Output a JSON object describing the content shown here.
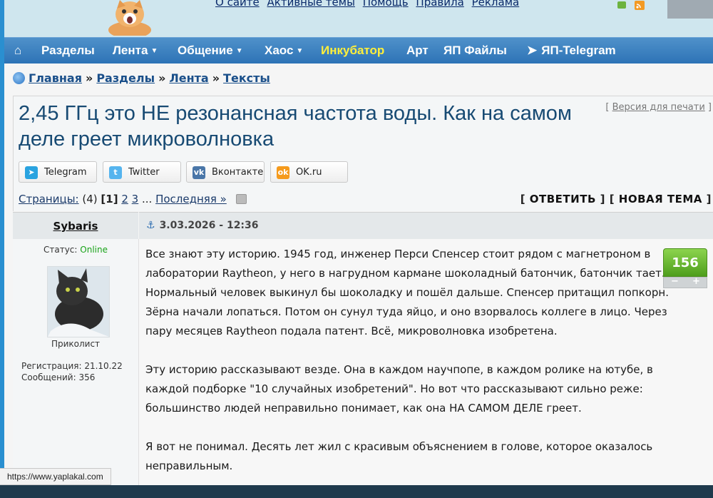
{
  "header": {
    "top_links": [
      "О сайте",
      "Активные темы",
      "Помощь",
      "Правила",
      "Реклама"
    ]
  },
  "navbar": {
    "items": [
      {
        "label": "Разделы",
        "dropdown": false
      },
      {
        "label": "Лента",
        "dropdown": true
      },
      {
        "label": "Общение",
        "dropdown": true
      },
      {
        "label": "Хаос",
        "dropdown": true
      },
      {
        "label": "Инкубатор",
        "dropdown": false,
        "highlight": true
      },
      {
        "label": "Арт",
        "dropdown": false
      },
      {
        "label": "ЯП Файлы",
        "dropdown": false
      },
      {
        "label": "ЯП-Telegram",
        "dropdown": false
      }
    ]
  },
  "breadcrumb": [
    "Главная",
    "Разделы",
    "Лента",
    "Тексты"
  ],
  "topic": {
    "title": "2,45 ГГц это НЕ резонансная частота воды. Как на самом деле греет микроволновка",
    "print_version": "Версия для печати"
  },
  "share": {
    "buttons": [
      {
        "label": "Telegram",
        "color": "#2aa3e0"
      },
      {
        "label": "Twitter",
        "color": "#55b4ee"
      },
      {
        "label": "Вконтакте",
        "color": "#4a76a8"
      },
      {
        "label": "OK.ru",
        "color": "#f59a1c"
      }
    ]
  },
  "pager": {
    "label": "Страницы:",
    "total": "(4)",
    "current": "[1]",
    "pages": [
      "2",
      "3"
    ],
    "ellipsis": "...",
    "last": "Последняя »"
  },
  "actions": {
    "reply": "ОТВЕТИТЬ",
    "new_topic": "НОВАЯ ТЕМА"
  },
  "post": {
    "author": "Sybaris",
    "status_label": "Статус:",
    "status_value": "Online",
    "rank": "Приколист",
    "registration": "Регистрация: 21.10.22",
    "messages": "Сообщений: 356",
    "date": "3.03.2026 - 12:36",
    "rating": "156",
    "paragraphs": [
      "Все знают эту историю. 1945 год, инженер Перси Спенсер стоит рядом с магнетроном в лаборатории Raytheon, у него в нагрудном кармане шоколадный батончик, батончик тает. Нормальный человек выкинул бы шоколадку и пошёл дальше. Спенсер притащил попкорн. Зёрна начали лопаться. Потом он сунул туда яйцо, и оно взорвалось коллеге в лицо. Через пару месяцев Raytheon подала патент. Всё, микроволновка изобретена.",
      "Эту историю рассказывают везде. Она в каждом научпопе, в каждом ролике на ютубе, в каждой подборке \"10 случайных изобретений\". Но вот что рассказывают сильно реже: большинство людей неправильно понимает, как она НА САМОМ ДЕЛЕ греет.",
      "Я вот не понимал. Десять лет жил с красивым объяснением в голове, которое оказалось неправильным."
    ]
  },
  "statusbar": {
    "url": "https://www.yaplakal.com"
  }
}
